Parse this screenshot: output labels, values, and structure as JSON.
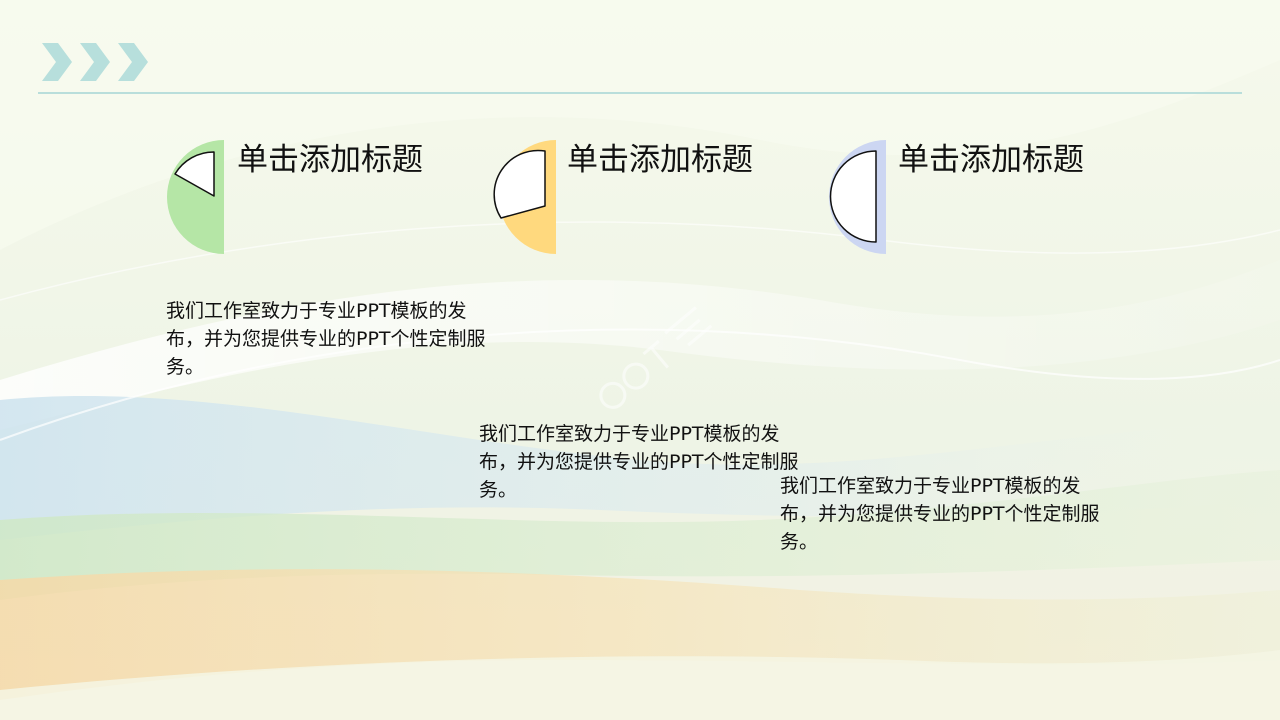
{
  "slide": {
    "accent_color": "#b9dedb",
    "cards": [
      {
        "title": "单击添加标题",
        "body": "我们工作室致力于专业PPT模板的发布，并为您提供专业的PPT个性定制服务。",
        "color": "#b5e6a6",
        "icon": "pie-quarter-icon"
      },
      {
        "title": "单击添加标题",
        "body": "我们工作室致力于专业PPT模板的发布，并为您提供专业的PPT个性定制服务。",
        "color": "#ffd97e",
        "icon": "pie-half-icon"
      },
      {
        "title": "单击添加标题",
        "body": "我们工作室致力于专业PPT模板的发布，并为您提供专业的PPT个性定制服务。",
        "color": "#ccd6f2",
        "icon": "pie-three-quarter-icon"
      }
    ],
    "watermark": "ppt系词"
  }
}
